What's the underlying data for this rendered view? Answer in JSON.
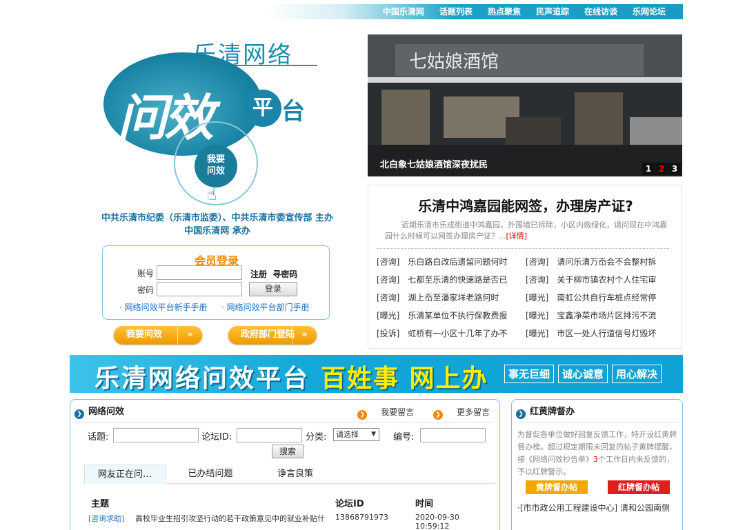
{
  "topnav": [
    "中国乐清网",
    "话题列表",
    "热点聚焦",
    "民声追踪",
    "在线访谈",
    "乐网论坛"
  ],
  "logo": {
    "title": "乐清网络",
    "big": "问效",
    "ping": "平",
    "tai": "台",
    "ask_line1": "我要",
    "ask_line2": "问效"
  },
  "sponsor": {
    "line1": "中共乐清市纪委（乐清市监委）、中共乐清市委宣传部 主办",
    "line2": "中国乐清网 承办"
  },
  "login": {
    "title": "会员登录",
    "account_label": "账号",
    "password_label": "密码",
    "register": "注册",
    "find_password": "寻密码",
    "submit": "登录",
    "manual1": "· 网络问效平台新手手册",
    "manual2": "· 网络问效平台部门手册"
  },
  "buttons": {
    "ask": "我要问效",
    "gov": "政府部门登陆",
    "arrow": "»"
  },
  "carousel": {
    "caption": "北白象七姑娘酒馆深夜扰民",
    "sign": "七姑娘酒馆",
    "pages": [
      "1",
      "2",
      "3"
    ],
    "active_page": "2"
  },
  "topic": {
    "title": "乐清中鸿嘉园能网签，办理房产证?",
    "summary": "近期乐清市乐成街道中鸿嘉园，外围墙已拆除，小区内做绿化，请问现在中鸿嘉园什么时候可以网签办理房产证？...",
    "more": "[详情]",
    "rows": [
      [
        {
          "tag": "[咨询]",
          "text": "乐白路白改后遗留问题何时"
        },
        {
          "tag": "[咨询]",
          "text": "请问乐清万岙会不会整村拆"
        }
      ],
      [
        {
          "tag": "[咨询]",
          "text": "七都至乐清的快速路是否已"
        },
        {
          "tag": "[咨询]",
          "text": "关于柳市镇农村个人住宅审"
        }
      ],
      [
        {
          "tag": "[咨询]",
          "text": "湖上岙至潘家垟老路何时"
        },
        {
          "tag": "[曝光]",
          "text": "南虹公共自行车桩点经常停"
        }
      ],
      [
        {
          "tag": "[曝光]",
          "text": "乐清某单位不执行保教费报"
        },
        {
          "tag": "[曝光]",
          "text": "宝鑫净菜市场片区排污不流"
        }
      ],
      [
        {
          "tag": "[投诉]",
          "text": "虹桥有一小区十几年了办不"
        },
        {
          "tag": "[曝光]",
          "text": "市区一处人行道信号灯毁坏"
        }
      ]
    ]
  },
  "banner": {
    "main": "乐清网络问效平台",
    "slogan": "百姓事 网上办",
    "tags": [
      "事无巨细",
      "诚心诚意",
      "用心解决"
    ]
  },
  "forum": {
    "title": "网络问效",
    "leave_msg": "我要留言",
    "more_msg": "更多留言",
    "topic_label": "话题:",
    "forum_id_label": "论坛ID:",
    "category_label": "分类:",
    "category_value": "请选择",
    "number_label": "编号:",
    "search": "搜索",
    "tabs": [
      "网友正在问…",
      "已办结问题",
      "诤言良策"
    ],
    "cols": [
      "主题",
      "论坛ID",
      "时间"
    ],
    "rows": [
      {
        "tag": "[咨询求助]",
        "title": "高校毕业生招引攻坚行动的若干政策意见中的就业补贴什",
        "id": "13868791973",
        "time": "2020-09-30 10:59:12"
      }
    ]
  },
  "rypanel": {
    "title": "红黄牌督办",
    "desc1": "为督促各单位做好回复反馈工作，特开设红黄牌督办榜。超过规定期限未回复的帖子黄牌提醒，接《网络问效抄告单》",
    "desc_num": "3",
    "desc2": "个工作日内未反馈的，予以红牌警示。",
    "yellow": "黄牌督办帖",
    "red": "红牌督办帖",
    "item": "·[市市政公用工程建设中心] 清和公园南侧"
  },
  "colors": {
    "accent": "#1a85a6",
    "orange": "#f08a00",
    "red": "#e21d1d",
    "yellow": "#f5a700"
  }
}
